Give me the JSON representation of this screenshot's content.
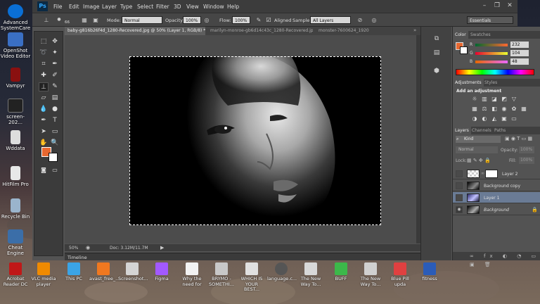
{
  "desktop_icons": [
    {
      "label": "Advanced SystemCare",
      "icon": "advanced-systemcare-icon"
    },
    {
      "label": "OpenShot Video Editor",
      "icon": "openshot-icon"
    },
    {
      "label": "Vampyr",
      "icon": "vampyr-icon"
    },
    {
      "label": "screen-202...",
      "icon": "video-file-icon"
    },
    {
      "label": "Wddata",
      "icon": "folder-icon"
    },
    {
      "label": "HitFilm Pro",
      "icon": "hitfilm-icon"
    },
    {
      "label": "Recycle Bin",
      "icon": "recycle-bin-icon"
    },
    {
      "label": "Cheat Engine",
      "icon": "cheat-engine-icon"
    }
  ],
  "taskbar_icons": [
    {
      "label": "Acrobat Reader DC"
    },
    {
      "label": "VLC media player"
    },
    {
      "label": "This PC"
    },
    {
      "label": "avast_free_..."
    },
    {
      "label": "Screenshot..."
    },
    {
      "label": "Figma"
    },
    {
      "label": "Why the need for"
    },
    {
      "label": "BRYMO - SOMETHI..."
    },
    {
      "label": "WHICH IS YOUR BEST..."
    },
    {
      "label": "language.c..."
    },
    {
      "label": "The New Way To..."
    },
    {
      "label": "BUFF"
    },
    {
      "label": "The New Way To..."
    },
    {
      "label": "Blue Pill upda"
    },
    {
      "label": "fitness"
    }
  ],
  "app": {
    "logo": "Ps",
    "menu": [
      "File",
      "Edit",
      "Image",
      "Layer",
      "Type",
      "Select",
      "Filter",
      "3D",
      "View",
      "Window",
      "Help"
    ],
    "window_controls": [
      "–",
      "❐",
      "✕"
    ]
  },
  "options_bar": {
    "brush_size": "66",
    "mode_label": "Mode:",
    "mode_value": "Normal",
    "opacity_label": "Opacity:",
    "opacity_value": "100%",
    "flow_label": "Flow:",
    "flow_value": "100%",
    "aligned_label": "Aligned",
    "sample_label": "Sample:",
    "sample_value": "All Layers",
    "workspace": "Essentials"
  },
  "doc_tabs": [
    {
      "label": "baby-g816b26f4d_1280-Recovered.jpg @ 50% (Layer 1, RGB/8) *",
      "active": true
    },
    {
      "label": "marilyn-monroe-gb6d14c43c_1280-Recovered.jpg",
      "active": false
    },
    {
      "label": "monster-7600624_1920",
      "active": false
    }
  ],
  "status": {
    "zoom": "50%",
    "doc": "Doc: 3.12M/11.7M"
  },
  "timeline": {
    "label": "Timeline"
  },
  "color_panel": {
    "tabs": [
      "Color",
      "Swatches"
    ],
    "channels": [
      {
        "name": "R",
        "value": "232"
      },
      {
        "name": "G",
        "value": "104"
      },
      {
        "name": "B",
        "value": "48"
      }
    ],
    "fg": "#e86830",
    "bg": "#ffffff"
  },
  "adjustments_panel": {
    "tabs": [
      "Adjustments",
      "Styles"
    ],
    "heading": "Add an adjustment"
  },
  "layers_panel": {
    "tabs": [
      "Layers",
      "Channels",
      "Paths"
    ],
    "kind_label": "Kind",
    "blend": "Normal",
    "opacity_label": "Opacity:",
    "opacity_value": "100%",
    "lock_label": "Lock:",
    "fill_label": "Fill:",
    "fill_value": "100%",
    "layers": [
      {
        "name": "Layer 2",
        "visible": false,
        "active": false
      },
      {
        "name": "Background copy",
        "visible": false,
        "active": false
      },
      {
        "name": "Layer 1",
        "visible": false,
        "active": true
      },
      {
        "name": "Background",
        "visible": true,
        "active": false
      }
    ]
  }
}
